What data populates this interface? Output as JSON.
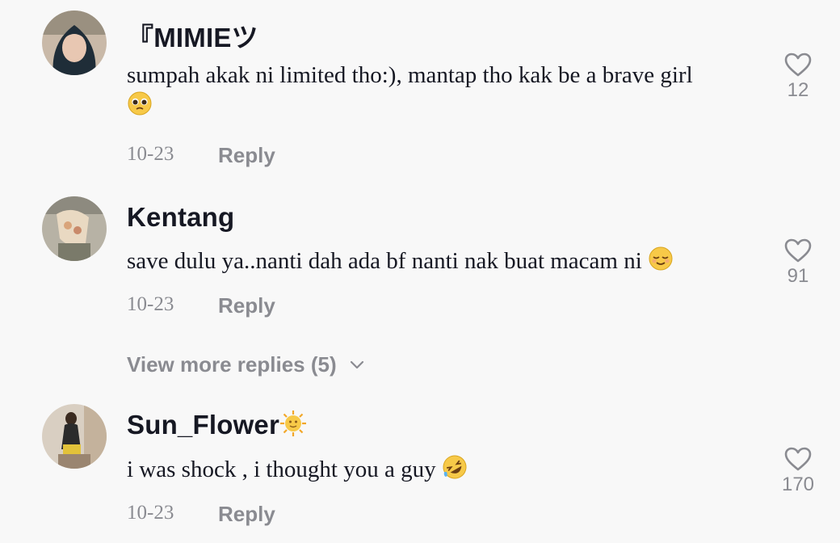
{
  "comments": [
    {
      "username": "『MIMIEツ",
      "text": "sumpah akak ni limited tho:), mantap tho kak be a brave girl",
      "emoji": "pleading-face-emoji",
      "date": "10-23",
      "reply_label": "Reply",
      "likes": "12",
      "avatar": "avatar-photo-hijab-girl"
    },
    {
      "username": "Kentang",
      "text": "save dulu ya..nanti dah ada bf nanti nak buat macam ni",
      "emoji": "relieved-face-emoji",
      "date": "10-23",
      "reply_label": "Reply",
      "likes": "91",
      "avatar": "avatar-photo-sticker"
    },
    {
      "username": "Sun_Flower",
      "username_emoji": "sun-emoji",
      "text": "i was shock , i thought you a guy",
      "emoji": "rolling-on-floor-laughing-emoji",
      "date": "10-23",
      "reply_label": "Reply",
      "likes": "170",
      "avatar": "avatar-photo-girl-sitting"
    }
  ],
  "view_more": {
    "label": "View more replies (5)",
    "icon": "chevron-down-icon"
  },
  "colors": {
    "background": "#f8f8f8",
    "primary_text": "#161823",
    "secondary_text": "#8a8b91"
  }
}
